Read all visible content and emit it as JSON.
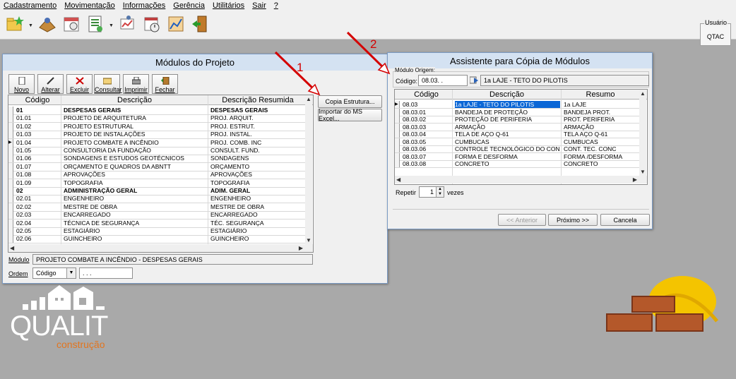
{
  "menu": [
    "Cadastramento",
    "Movimentação",
    "Informações",
    "Gerência",
    "Utilitários",
    "Sair",
    "?"
  ],
  "toolbar": {
    "icons": [
      "folder-star-icon",
      "worker-icon",
      "calendar-icon",
      "spreadsheet-icon",
      "chart-person-icon",
      "clock-calendar-icon",
      "graph-icon",
      "exit-door-icon"
    ]
  },
  "user": {
    "label": "Usuário",
    "value": "QTAC"
  },
  "modulos": {
    "title": "Módulos do Projeto",
    "buttons": [
      {
        "label": "Novo",
        "icon": "new-document-icon"
      },
      {
        "label": "Alterar",
        "icon": "pencil-icon"
      },
      {
        "label": "Excluir",
        "icon": "delete-x-icon"
      },
      {
        "label": "Consultar",
        "icon": "open-folder-icon"
      },
      {
        "label": "Imprimir",
        "icon": "printer-icon"
      },
      {
        "label": "Fechar",
        "icon": "close-door-icon"
      }
    ],
    "columns": [
      "Código",
      "Descrição",
      "Descrição Resumida"
    ],
    "rows": [
      {
        "code": "01",
        "desc": "DESPESAS GERAIS",
        "short": "DESPESAS GERAIS",
        "bold": true
      },
      {
        "code": "01.01",
        "desc": "PROJETO DE ARQUITETURA",
        "short": "PROJ. ARQUIT."
      },
      {
        "code": "01.02",
        "desc": "PROJETO ESTRUTURAL",
        "short": "PROJ. ESTRUT."
      },
      {
        "code": "01.03",
        "desc": "PROJETO DE INSTALAÇÕES",
        "short": "PROJ. INSTAL."
      },
      {
        "code": "01.04",
        "desc": "PROJETO COMBATE A INCÊNDIO",
        "short": "PROJ. COMB. INC",
        "current": true
      },
      {
        "code": "01.05",
        "desc": "CONSULTORIA DA FUNDAÇÃO",
        "short": "CONSULT. FUND."
      },
      {
        "code": "01.06",
        "desc": "SONDAGENS E ESTUDOS GEOTÉCNICOS",
        "short": "SONDAGENS"
      },
      {
        "code": "01.07",
        "desc": "ORÇAMENTO E QUADROS DA ABNTT",
        "short": "ORÇAMENTO"
      },
      {
        "code": "01.08",
        "desc": "APROVAÇÕES",
        "short": "APROVAÇÕES"
      },
      {
        "code": "01.09",
        "desc": "TOPOGRAFIA",
        "short": "TOPOGRAFIA"
      },
      {
        "code": "02",
        "desc": "ADMINISTRAÇÃO GERAL",
        "short": "ADIM. GERAL",
        "bold": true
      },
      {
        "code": "02.01",
        "desc": "ENGENHEIRO",
        "short": "ENGENHEIRO"
      },
      {
        "code": "02.02",
        "desc": "MESTRE DE OBRA",
        "short": "MESTRE DE OBRA"
      },
      {
        "code": "02.03",
        "desc": "ENCARREGADO",
        "short": "ENCARREGADO"
      },
      {
        "code": "02.04",
        "desc": "TÉCNICA DE SEGURANÇA",
        "short": "TÉC. SEGURANÇA"
      },
      {
        "code": "02.05",
        "desc": "ESTAGIÁRIO",
        "short": "ESTAGIÁRIO"
      },
      {
        "code": "02.06",
        "desc": "GUINCHEIRO",
        "short": "GUINCHEIRO"
      }
    ],
    "side_buttons": [
      "Copia Estrutura...",
      "Importar do MS Excel..."
    ],
    "modulo_label": "Módulo",
    "modulo_value": "PROJETO COMBATE A INCÊNDIO - DESPESAS GERAIS",
    "ordem_label": "Ordem",
    "ordem_value": "Código",
    "ordem_search": ". . ."
  },
  "assistente": {
    "title": "Assistente para Cópia de Módulos",
    "group_label": "Módulo Origem:",
    "codigo_label": "Código:",
    "codigo_value": "08.03.   .",
    "origin_desc": "1a LAJE - TETO DO PILOTIS",
    "columns": [
      "Código",
      "Descrição",
      "Resumo"
    ],
    "rows": [
      {
        "code": "08.03",
        "desc": "1a LAJE - TETO DO PILOTIS",
        "short": "1a LAJE",
        "selected": true
      },
      {
        "code": "08.03.01",
        "desc": "BANDEJA DE PROTEÇÃO",
        "short": "BANDEJA PROT."
      },
      {
        "code": "08.03.02",
        "desc": "PROTEÇÃO DE PERIFERIA",
        "short": "PROT. PERIFERIA"
      },
      {
        "code": "08.03.03",
        "desc": "ARMAÇÃO",
        "short": "ARMAÇÃO"
      },
      {
        "code": "08.03.04",
        "desc": "TELA DE AÇO Q-61",
        "short": "TELA AÇO Q-61"
      },
      {
        "code": "08.03.05",
        "desc": "CUMBUCAS",
        "short": "CUMBUCAS"
      },
      {
        "code": "08.03.06",
        "desc": "CONTROLE TECNOLÓGICO DO CONCRE",
        "short": "CONT. TEC. CONC"
      },
      {
        "code": "08.03.07",
        "desc": "FORMA E DESFORMA",
        "short": "FORMA /DESFORMA"
      },
      {
        "code": "08.03.08",
        "desc": "CONCRETO",
        "short": "CONCRETO"
      }
    ],
    "repetir_label": "Repetir",
    "repetir_value": "1",
    "vezes_label": "vezes",
    "buttons": [
      "<< Anterior",
      "Próximo >>",
      "Cancela"
    ]
  },
  "annotations": [
    "1",
    "2"
  ],
  "logo": {
    "brand": "QUALIT",
    "sub": "construção"
  },
  "colors": {
    "annotation": "#d40000",
    "selection": "#0a66d6",
    "logo_orange": "#e2751f"
  }
}
